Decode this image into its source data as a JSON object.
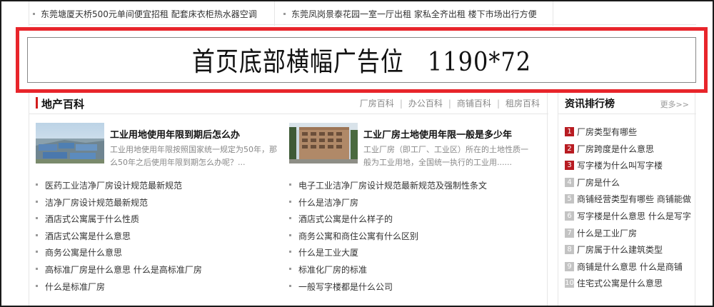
{
  "top_links": [
    "东莞塘厦天桥500元单间便宜招租 配套床衣柜热水器空调",
    "东莞凤岗景泰花园一室一厅出租 家私全齐出租 楼下市场出行方便"
  ],
  "banner": {
    "text": "首页底部横幅广告位　1190*72",
    "border_color": "#e8252b"
  },
  "estate_wiki": {
    "title": "地产百科",
    "tabs": [
      "厂房百科",
      "办公百科",
      "商铺百科",
      "租房百科"
    ],
    "features": [
      {
        "title": "工业用地使用年限到期后怎么办",
        "desc": "工业用地使用年限按照国家统一规定为50年，那么50年之后使用年限到期怎么办呢？...",
        "image": "industrial-park-photo"
      },
      {
        "title": "工业厂房土地使用年限一般是多少年",
        "desc": "工业厂房（即工厂、工业区）所在的土地性质一般为工业用地，全国统一执行的工业用......",
        "image": "factory-building-photo"
      }
    ],
    "list_left": [
      "医药工业洁净厂房设计规范最新规范",
      "洁净厂房设计规范最新规范",
      "酒店式公寓属于什么性质",
      "酒店式公寓是什么意思",
      "商务公寓是什么意思",
      "高标准厂房是什么意思 什么是高标准厂房",
      "什么是标准厂房"
    ],
    "list_right": [
      "电子工业洁净厂房设计规范最新规范及强制性条文",
      "什么是洁净厂房",
      "酒店式公寓是什么样子的",
      "商务公寓和商住公寓有什么区别",
      "什么是工业大厦",
      "标准化厂房的标准",
      "一般写字楼都是什么公司"
    ]
  },
  "ranking": {
    "title": "资讯排行榜",
    "more": "更多>>",
    "accent": "#b81c22",
    "items": [
      {
        "num": "1",
        "text": "厂房类型有哪些"
      },
      {
        "num": "2",
        "text": "厂房跨度是什么意思"
      },
      {
        "num": "3",
        "text": "写字楼为什么叫写字楼"
      },
      {
        "num": "4",
        "text": "厂房是什么"
      },
      {
        "num": "5",
        "text": "商铺经营类型有哪些 商铺能做..."
      },
      {
        "num": "6",
        "text": "写字楼是什么意思 什么是写字楼"
      },
      {
        "num": "7",
        "text": "什么是工业厂房"
      },
      {
        "num": "8",
        "text": "厂房属于什么建筑类型"
      },
      {
        "num": "9",
        "text": "商铺是什么意思 什么是商铺"
      },
      {
        "num": "10",
        "text": "住宅式公寓是什么意思"
      }
    ]
  }
}
